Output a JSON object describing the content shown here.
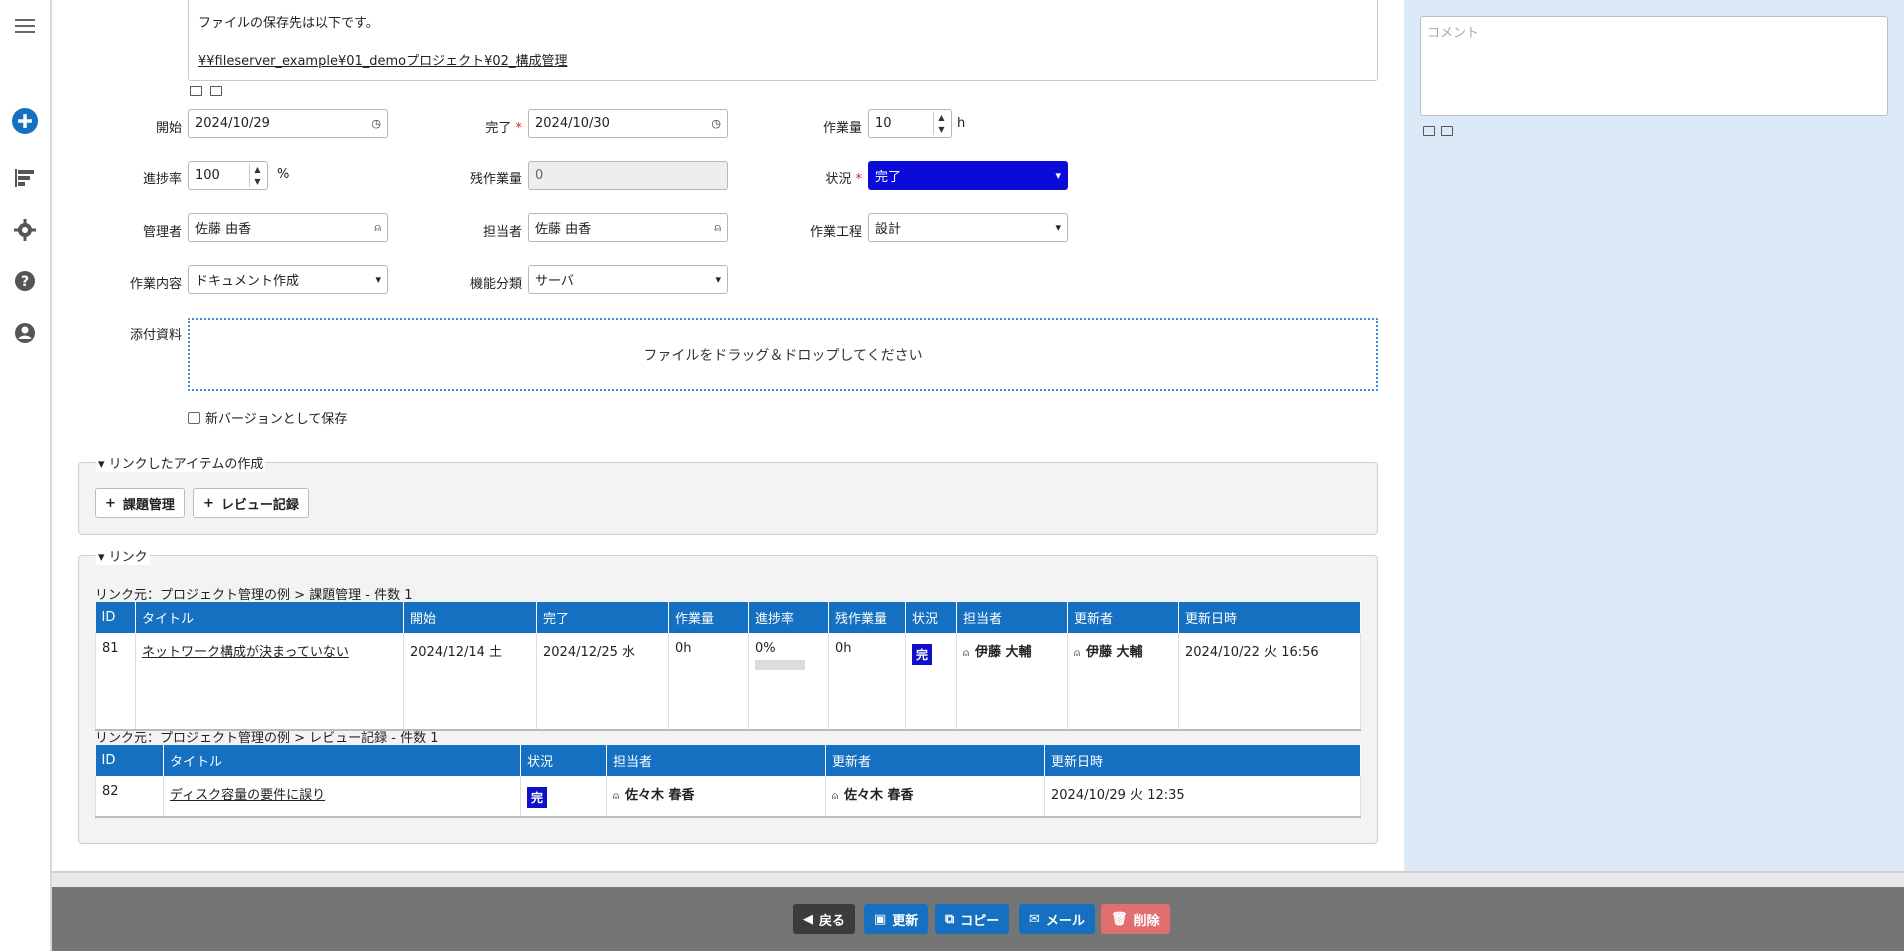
{
  "rail": {
    "icons": [
      "menu-icon",
      "add-circle-icon",
      "gantt-icon",
      "gear-icon",
      "help-icon",
      "user-icon"
    ]
  },
  "body_text": {
    "line1": "ファイルの保存先は以下です。",
    "line2": "¥¥fileserver_example¥01_demoプロジェクト¥02_構成管理"
  },
  "form": {
    "start": {
      "label": "開始",
      "value": "2024/10/29"
    },
    "end": {
      "label": "完了",
      "required": "*",
      "value": "2024/10/30"
    },
    "work_volume": {
      "label": "作業量",
      "value": "10",
      "unit": "h"
    },
    "progress": {
      "label": "進捗率",
      "value": "100",
      "unit": "%"
    },
    "remaining": {
      "label": "残作業量",
      "value": "0"
    },
    "status": {
      "label": "状況",
      "required": "*",
      "value": "完了"
    },
    "manager": {
      "label": "管理者",
      "value": "佐藤 由香"
    },
    "owner": {
      "label": "担当者",
      "value": "佐藤 由香"
    },
    "process": {
      "label": "作業工程",
      "value": "設計"
    },
    "content": {
      "label": "作業内容",
      "value": "ドキュメント作成"
    },
    "function": {
      "label": "機能分類",
      "value": "サーバ"
    },
    "attachments": {
      "label": "添付資料",
      "drop_text": "ファイルをドラッグ＆ドロップしてください"
    },
    "new_version_label": "新バージョンとして保存"
  },
  "linked_create": {
    "legend": "リンクしたアイテムの作成",
    "buttons": [
      "課題管理",
      "レビュー記録"
    ]
  },
  "links": {
    "legend": "リンク",
    "issues": {
      "caption": "リンク元：プロジェクト管理の例 > 課題管理 - 件数 1",
      "headers": [
        "ID",
        "タイトル",
        "開始",
        "完了",
        "作業量",
        "進捗率",
        "残作業量",
        "状況",
        "担当者",
        "更新者",
        "更新日時"
      ],
      "row": {
        "id": "81",
        "title": "ネットワーク構成が決まっていない",
        "start": "2024/12/14 土",
        "end": "2024/12/25 水",
        "work": "0h",
        "progress": "0%",
        "progress_value": 0,
        "remaining": "0h",
        "status": "完",
        "owner": "伊藤 大輔",
        "updater": "伊藤 大輔",
        "updated": "2024/10/22 火 16:56"
      }
    },
    "reviews": {
      "caption": "リンク元：プロジェクト管理の例 > レビュー記録 - 件数 1",
      "headers": [
        "ID",
        "タイトル",
        "状況",
        "担当者",
        "更新者",
        "更新日時"
      ],
      "row": {
        "id": "82",
        "title": "ディスク容量の要件に誤り",
        "status": "完",
        "owner": "佐々木 春香",
        "updater": "佐々木 春香",
        "updated": "2024/10/29 火 12:35"
      }
    }
  },
  "comment": {
    "placeholder": "コメント"
  },
  "footer": {
    "back": "戻る",
    "update": "更新",
    "copy": "コピー",
    "mail": "メール",
    "delete": "削除",
    "colors": {
      "back": "#3c3c3c",
      "primary": "#1570c2",
      "delete": "#e07070"
    }
  }
}
